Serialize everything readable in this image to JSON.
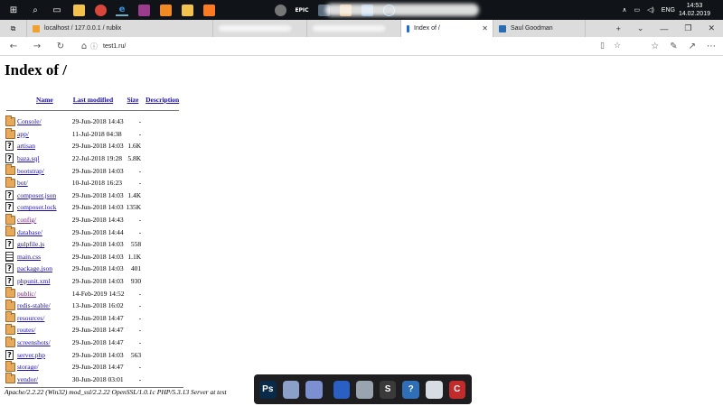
{
  "taskbar": {
    "icons": [
      "windows-icon",
      "search-icon",
      "task-view-icon",
      "file-explorer-icon",
      "chrome-icon",
      "edge-icon",
      "winrar-icon",
      "sublime-icon",
      "folder-icon",
      "xampp-icon",
      "game-icon",
      "epic-icon",
      "app-icon",
      "box-icon",
      "box2-icon",
      "steam-icon"
    ],
    "tray_language": "ENG",
    "time": "14:53",
    "date": "14.02.2019",
    "epic_label": "EPIC"
  },
  "tabs": [
    {
      "label": "localhost / 127.0.0.1 / rublix",
      "favicon_color": "#f0a030"
    },
    {
      "label": "",
      "favicon_color": "#888888"
    },
    {
      "label": "",
      "favicon_color": "#888888"
    },
    {
      "label": "Index of /",
      "favicon_color": "#1c6fc4",
      "active": true
    },
    {
      "label": "Saul Goodman",
      "favicon_color": "#2b6cb0"
    }
  ],
  "address": {
    "url": "test1.ru/"
  },
  "page": {
    "title": "Index of /",
    "columns": {
      "name": "Name",
      "modified": "Last modified",
      "size": "Size",
      "description": "Description"
    },
    "rows": [
      {
        "type": "folder",
        "name": "Console/",
        "modified": "29-Jun-2018 14:43",
        "size": "-"
      },
      {
        "type": "folder",
        "name": "app/",
        "modified": "11-Jul-2018 04:38",
        "size": "-"
      },
      {
        "type": "unknown",
        "name": "artisan",
        "modified": "29-Jun-2018 14:03",
        "size": "1.6K"
      },
      {
        "type": "unknown",
        "name": "baza.sql",
        "modified": "22-Jul-2018 19:28",
        "size": "5.8K"
      },
      {
        "type": "folder",
        "name": "bootstrap/",
        "modified": "29-Jun-2018 14:03",
        "size": "-"
      },
      {
        "type": "folder",
        "name": "bot/",
        "modified": "10-Jul-2018 16:23",
        "size": "-"
      },
      {
        "type": "unknown",
        "name": "composer.json",
        "modified": "29-Jun-2018 14:03",
        "size": "1.4K"
      },
      {
        "type": "unknown",
        "name": "composer.lock",
        "modified": "29-Jun-2018 14:03",
        "size": "135K"
      },
      {
        "type": "folder",
        "name": "config/",
        "modified": "29-Jun-2018 14:43",
        "size": "-",
        "visited": true
      },
      {
        "type": "folder",
        "name": "database/",
        "modified": "29-Jun-2018 14:44",
        "size": "-"
      },
      {
        "type": "unknown",
        "name": "gulpfile.js",
        "modified": "29-Jun-2018 14:03",
        "size": "558"
      },
      {
        "type": "text",
        "name": "main.css",
        "modified": "29-Jun-2018 14:03",
        "size": "1.1K"
      },
      {
        "type": "unknown",
        "name": "package.json",
        "modified": "29-Jun-2018 14:03",
        "size": "401"
      },
      {
        "type": "unknown",
        "name": "phpunit.xml",
        "modified": "29-Jun-2018 14:03",
        "size": "930"
      },
      {
        "type": "folder",
        "name": "public/",
        "modified": "14-Feb-2019 14:52",
        "size": "-",
        "visited": true
      },
      {
        "type": "folder",
        "name": "redis-stable/",
        "modified": "13-Jun-2018 16:02",
        "size": "-"
      },
      {
        "type": "folder",
        "name": "resources/",
        "modified": "29-Jun-2018 14:47",
        "size": "-"
      },
      {
        "type": "folder",
        "name": "routes/",
        "modified": "29-Jun-2018 14:47",
        "size": "-"
      },
      {
        "type": "folder",
        "name": "screenshots/",
        "modified": "29-Jun-2018 14:47",
        "size": "-"
      },
      {
        "type": "unknown",
        "name": "server.php",
        "modified": "29-Jun-2018 14:03",
        "size": "563"
      },
      {
        "type": "folder",
        "name": "storage/",
        "modified": "29-Jun-2018 14:47",
        "size": "-"
      },
      {
        "type": "folder",
        "name": "vendor/",
        "modified": "30-Jun-2018 03:01",
        "size": "-"
      }
    ],
    "footer": "Apache/2.2.22 (Win32) mod_ssl/2.2.22 OpenSSL/1.0.1c PHP/5.3.13 Server at test"
  },
  "dock": {
    "icons": [
      {
        "name": "photoshop-icon",
        "glyph": "Ps",
        "color": "#0a2a4a"
      },
      {
        "name": "folder-icon",
        "glyph": "",
        "color": "#8aa0c8"
      },
      {
        "name": "documents-icon",
        "glyph": "",
        "color": "#7c8fd0"
      },
      {
        "name": "app-store-icon",
        "glyph": "",
        "color": "#2a5fc4"
      },
      {
        "name": "globe-icon",
        "glyph": "",
        "color": "#9aa4ae"
      },
      {
        "name": "sublime-icon",
        "glyph": "S",
        "color": "#3a3a3a"
      },
      {
        "name": "help-icon",
        "glyph": "?",
        "color": "#2f6fb8"
      },
      {
        "name": "trash-icon",
        "glyph": "",
        "color": "#d8dde3"
      },
      {
        "name": "ccleaner-icon",
        "glyph": "C",
        "color": "#c22b2b"
      }
    ]
  }
}
